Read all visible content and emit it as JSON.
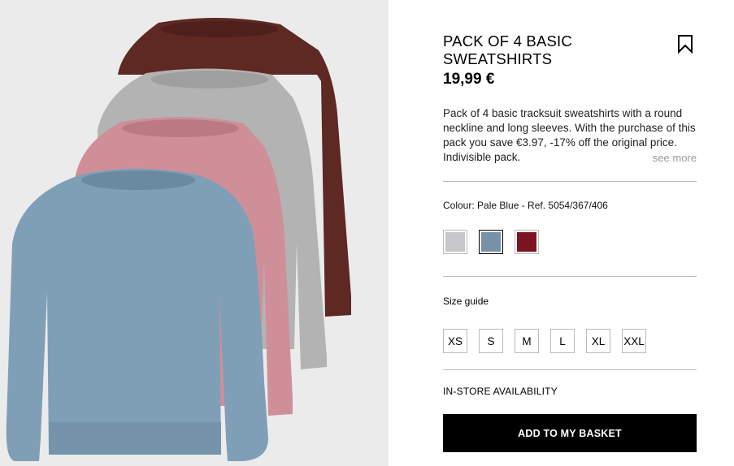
{
  "product": {
    "title": "PACK OF 4 BASIC SWEATSHIRTS",
    "price": "19,99 €",
    "description": "Pack of 4 basic tracksuit sweatshirts with a round neckline and long sleeves. With the purchase of this pack you save €3.97, -17% off the original price. Indivisible pack.",
    "see_more": "see more",
    "colour_label": "Colour: Pale Blue - Ref. 5054/367/406",
    "colours": [
      {
        "name": "grey",
        "hex": "#c7c7c9",
        "selected": false
      },
      {
        "name": "pale-blue",
        "hex": "#7791a9",
        "selected": true
      },
      {
        "name": "burgundy",
        "hex": "#7a1420",
        "selected": false
      }
    ],
    "size_guide": "Size guide",
    "sizes": [
      "XS",
      "S",
      "M",
      "L",
      "XL",
      "XXL"
    ],
    "in_store": "IN-STORE AVAILABILITY",
    "add_to_basket": "ADD TO MY BASKET"
  },
  "image": {
    "icon": "sweatshirts-photo",
    "sweatshirt_colors": [
      "#5e2823",
      "#b3b3b3",
      "#cf8f99",
      "#7f9fb7"
    ]
  }
}
